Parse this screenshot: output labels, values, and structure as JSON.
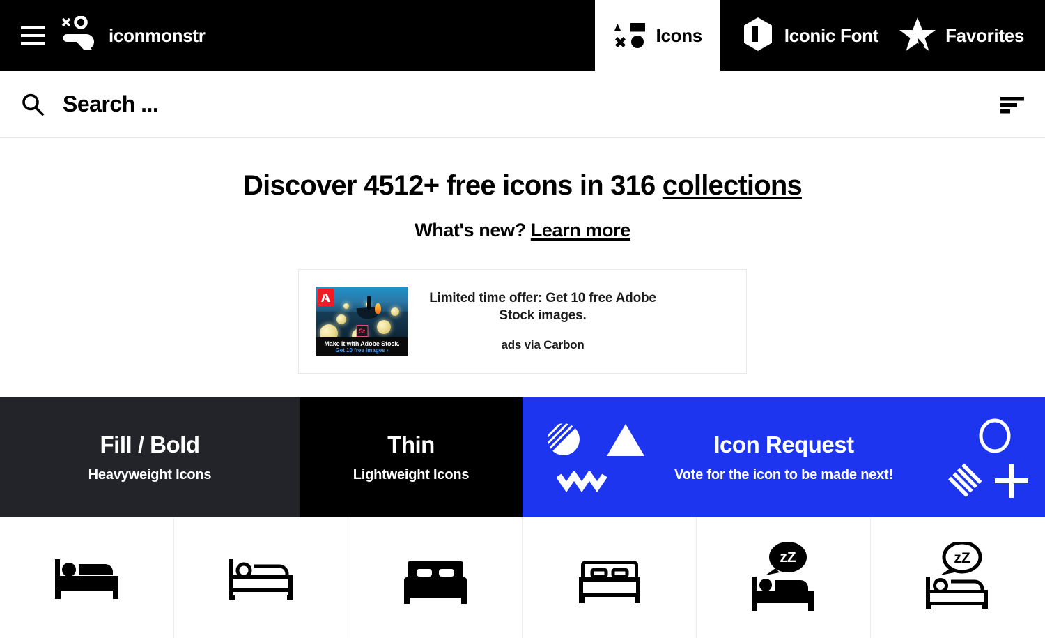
{
  "nav": {
    "menu_icon": "hamburger-icon",
    "brand_icon": "iconmonstr-logo-icon",
    "brand": "iconmonstr",
    "tabs": [
      {
        "label": "Icons",
        "icon": "shapes-grid-icon",
        "active": true
      },
      {
        "label": "Iconic Font",
        "icon": "hexagon-p-icon",
        "active": false
      }
    ],
    "favorites": {
      "label": "Favorites",
      "icon": "star-icon"
    }
  },
  "search": {
    "icon": "search-icon",
    "placeholder": "Search ...",
    "value": "",
    "sort_icon": "sort-descending-icon"
  },
  "hero": {
    "title_before": "Discover 4512+ free icons in 316 ",
    "title_link": "collections",
    "icon_count": "4512+",
    "collection_count": "316",
    "sub_before": "What's new? ",
    "sub_link": "Learn more"
  },
  "ad": {
    "headline": "Limited time offer: Get 10 free Adobe Stock images.",
    "via": "ads via Carbon",
    "thumb": {
      "brand_mark": "adobe-logo-icon",
      "badge": "St",
      "caption": "Make it with Adobe Stock.",
      "cta": "Get 10 free images ›"
    }
  },
  "banners": [
    {
      "name": "fill-bold",
      "title": "Fill / Bold",
      "subtitle": "Heavyweight Icons",
      "bg": "#222429"
    },
    {
      "name": "thin",
      "title": "Thin",
      "subtitle": "Lightweight Icons",
      "bg": "#000000"
    },
    {
      "name": "icon-request",
      "title": "Icon Request",
      "subtitle": "Vote for the icon to be made next!",
      "bg": "#1d35ef"
    }
  ],
  "icon_grid": [
    {
      "name": "bed-sleep-person-fill",
      "style": "fill"
    },
    {
      "name": "bed-sleep-person-thin",
      "style": "thin"
    },
    {
      "name": "bed-double-fill",
      "style": "fill"
    },
    {
      "name": "bed-double-thin",
      "style": "thin"
    },
    {
      "name": "bed-sleeping-zz-fill",
      "style": "fill",
      "label": "zZ"
    },
    {
      "name": "bed-sleeping-zz-thin",
      "style": "thin",
      "label": "zZ"
    }
  ],
  "colors": {
    "accent_blue": "#1d35ef",
    "dark_panel": "#222429",
    "black": "#000000",
    "grid_border": "#ededed"
  }
}
